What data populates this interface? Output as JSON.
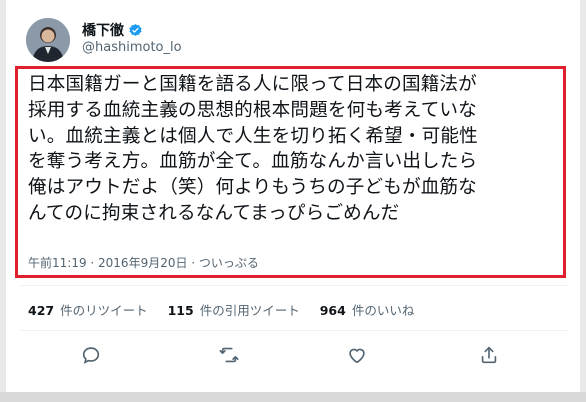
{
  "user": {
    "name": "橋下徹",
    "handle": "@hashimoto_lo",
    "verified_color": "#1d9bf0"
  },
  "tweet": {
    "lines": [
      "日本国籍ガーと国籍を語る人に限って日本の国籍法が",
      "採用する血統主義の思想的根本問題を何も考えていな",
      "い。血統主義とは個人で人生を切り拓く希望・可能性",
      "を奪う考え方。血筋が全て。血筋なんか言い出したら",
      "俺はアウトだよ（笑）何よりもうちの子どもが血筋な",
      "んてのに拘束されるなんてまっぴらごめんだ"
    ],
    "meta": "午前11:19 · 2016年9月20日 · ついっぷる"
  },
  "stats": {
    "retweets": {
      "count": "427",
      "label": "件のリツイート"
    },
    "quotes": {
      "count": "115",
      "label": "件の引用ツイート"
    },
    "likes": {
      "count": "964",
      "label": "件のいいね"
    }
  },
  "actions": [
    "reply-icon",
    "retweet-icon",
    "like-icon",
    "share-icon"
  ],
  "colors": {
    "highlight": "#e0202c",
    "muted": "#536471"
  }
}
